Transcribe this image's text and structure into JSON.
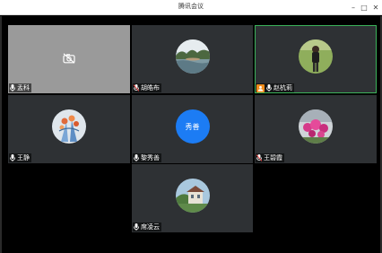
{
  "window": {
    "title": "腾讯会议",
    "minimize_glyph": "–",
    "maximize_glyph": "□",
    "close_glyph": "✕"
  },
  "participants": [
    {
      "name": "孟科",
      "video": "off",
      "mic": "muted"
    },
    {
      "name": "胡皓布",
      "video": "avatar",
      "mic": "muted"
    },
    {
      "name": "赵杭莉",
      "video": "avatar",
      "mic": "muted",
      "host": true,
      "speaking": true
    },
    {
      "name": "王静",
      "video": "avatar",
      "mic": "muted"
    },
    {
      "name": "黎秀善",
      "video": "text-avatar",
      "avatar_text": "秀善",
      "mic": "muted"
    },
    {
      "name": "王碧霞",
      "video": "avatar",
      "mic": "muted"
    },
    {
      "name": "席凌云",
      "video": "avatar",
      "mic": "muted"
    }
  ],
  "colors": {
    "tile_bg": "#2e3134",
    "camera_off_bg": "#9a9a9a",
    "active_border": "#3bb35a",
    "text_avatar_bg": "#1c7cf4",
    "host_badge": "#f08c1a"
  }
}
